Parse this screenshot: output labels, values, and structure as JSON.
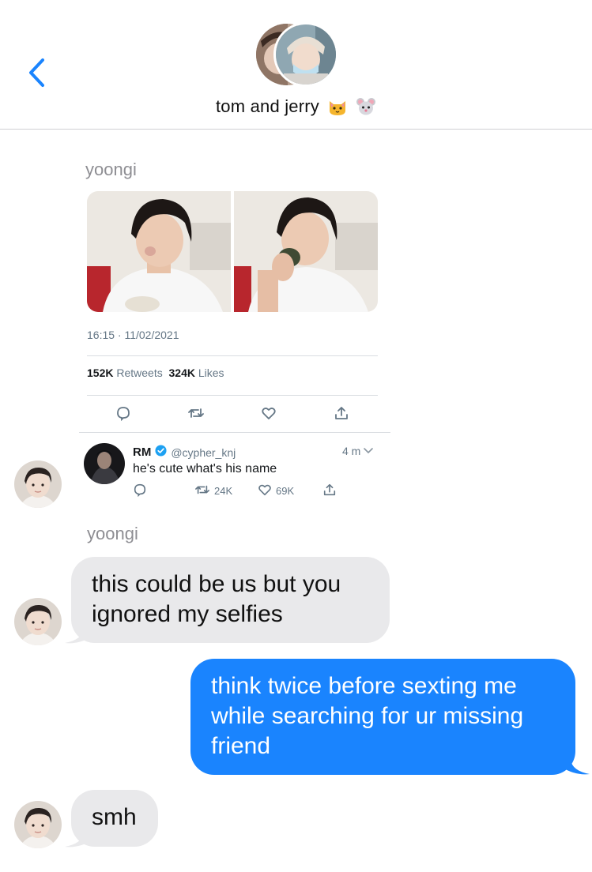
{
  "header": {
    "back_icon": "chevron-left-icon",
    "group_title": "tom and jerry",
    "emoji_1": "cat-face-emoji",
    "emoji_2": "mouse-face-emoji",
    "accent_color": "#1a84fe"
  },
  "thread": {
    "sender_1": "yoongi",
    "tweet": {
      "timestamp": "16:15 · 11/02/2021",
      "retweets_count": "152K",
      "retweets_label": "Retweets",
      "likes_count": "324K",
      "likes_label": "Likes",
      "actions": [
        "reply-icon",
        "retweet-icon",
        "like-icon",
        "share-icon"
      ]
    },
    "reply": {
      "name": "RM",
      "verified_icon": "verified-badge-icon",
      "handle": "@cypher_knj",
      "time": "4 m",
      "text": "he's cute what's his name",
      "retweets": "24K",
      "likes": "69K"
    },
    "sender_2": "yoongi",
    "messages": [
      {
        "from": "them",
        "text": "this could be us but you ignored my selfies"
      },
      {
        "from": "me",
        "text": "think twice before sexting me while searching for ur missing friend"
      },
      {
        "from": "them",
        "text": "smh"
      }
    ],
    "incoming_bubble_color": "#e9e9eb",
    "outgoing_bubble_color": "#1a84fe"
  }
}
